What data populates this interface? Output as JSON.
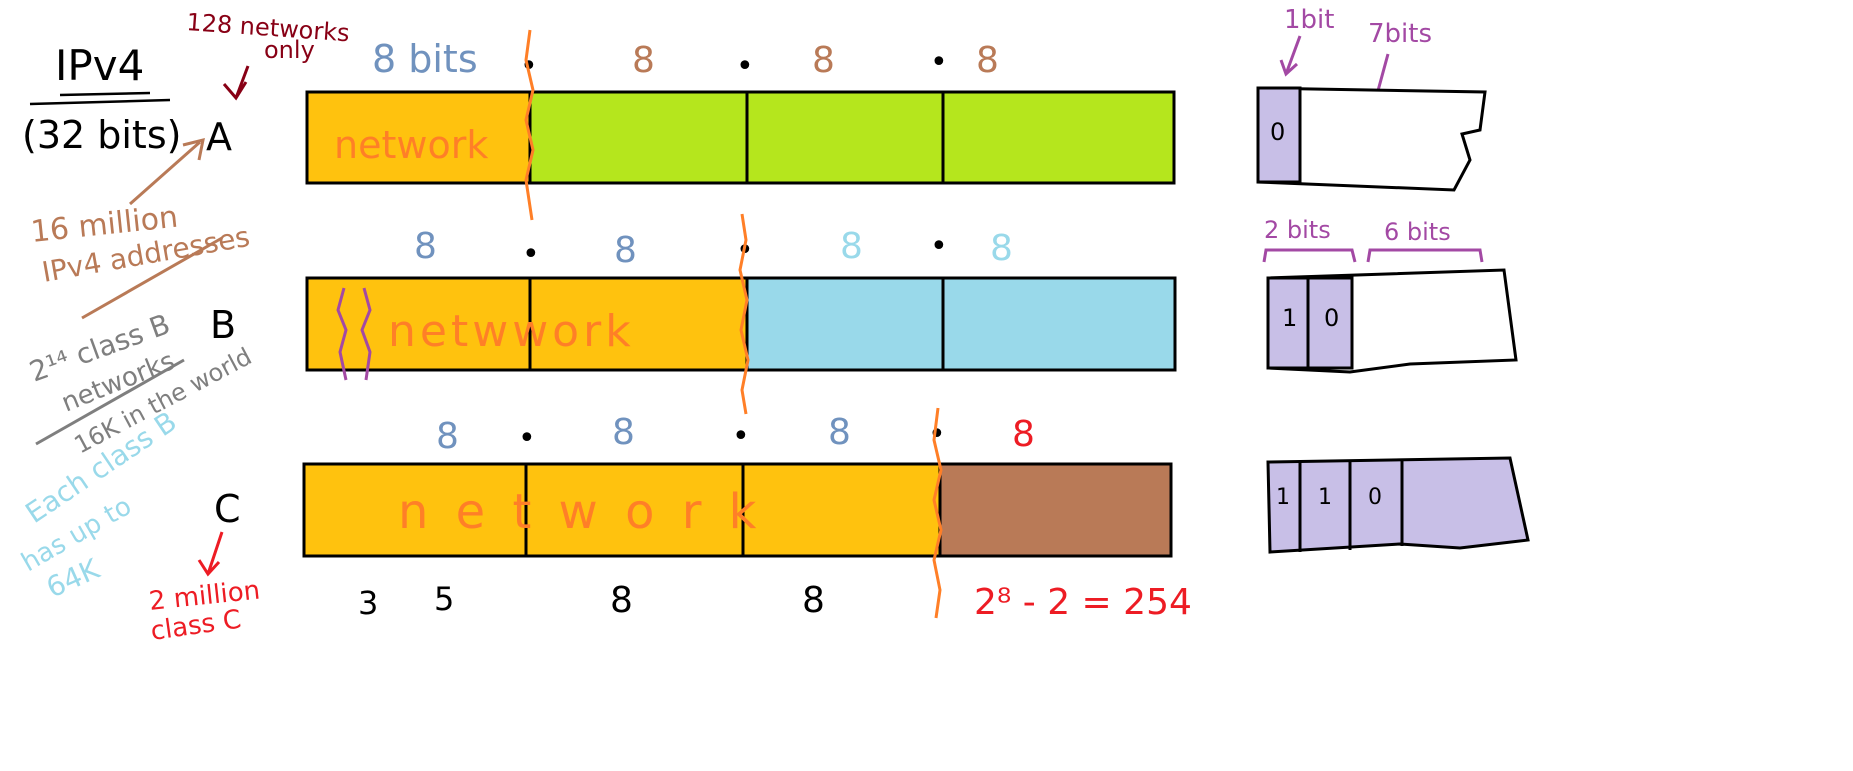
{
  "colors": {
    "network": "#ffc20e",
    "host_a": "#b5e61d",
    "host_b": "#99d9ea",
    "host_c": "#b97a57",
    "bits_box": "#c8bfe7",
    "outline": "#000000",
    "split_line": "#ff7f27",
    "network_text": "#ff7f27",
    "blue_ink": "#7092be",
    "light_blue_ink": "#99d9ea",
    "tan_ink": "#b97a57",
    "purple_ink": "#a349a4",
    "red_ink": "#ed1c24",
    "dark_red_ink": "#880015",
    "gray_ink": "#7f7f7f"
  },
  "title": {
    "line1": "IPv4",
    "line2": "(32 bits)"
  },
  "class_labels": {
    "a": "A",
    "b": "B",
    "c": "C"
  },
  "notes": {
    "a_networks": [
      "128 networks",
      "only"
    ],
    "a_addresses": [
      "16 million",
      "IPv4 addresses"
    ],
    "b_networks": [
      "2¹⁴ class B",
      "networks",
      "16K in the world"
    ],
    "b_each": [
      "Each class B",
      "has up to",
      "64K"
    ],
    "c_networks": [
      "2 million",
      "class C"
    ]
  },
  "rows": [
    {
      "name": "class-a",
      "octet_labels": [
        "8 bits",
        "8",
        "8",
        "8"
      ],
      "network_text": "network"
    },
    {
      "name": "class-b",
      "octet_labels": [
        "8",
        "8",
        "8",
        "8"
      ],
      "network_text": "netwwork"
    },
    {
      "name": "class-c",
      "octet_labels": [
        "8",
        "8",
        "8",
        "8"
      ],
      "network_text": "n e t w o r k"
    }
  ],
  "dot": "•",
  "bottom_labels": {
    "three": "3",
    "five": "5",
    "eight1": "8",
    "eight2": "8",
    "hosts_formula": "2⁸ - 2 = 254"
  },
  "prefix_boxes": {
    "a": {
      "bits": [
        "0"
      ],
      "label_left": "1bit",
      "label_right": "7bits"
    },
    "b": {
      "bits": [
        "1",
        "0"
      ],
      "label_left": "2 bits",
      "label_right": "6 bits"
    },
    "c": {
      "bits": [
        "1",
        "1",
        "0"
      ]
    }
  }
}
